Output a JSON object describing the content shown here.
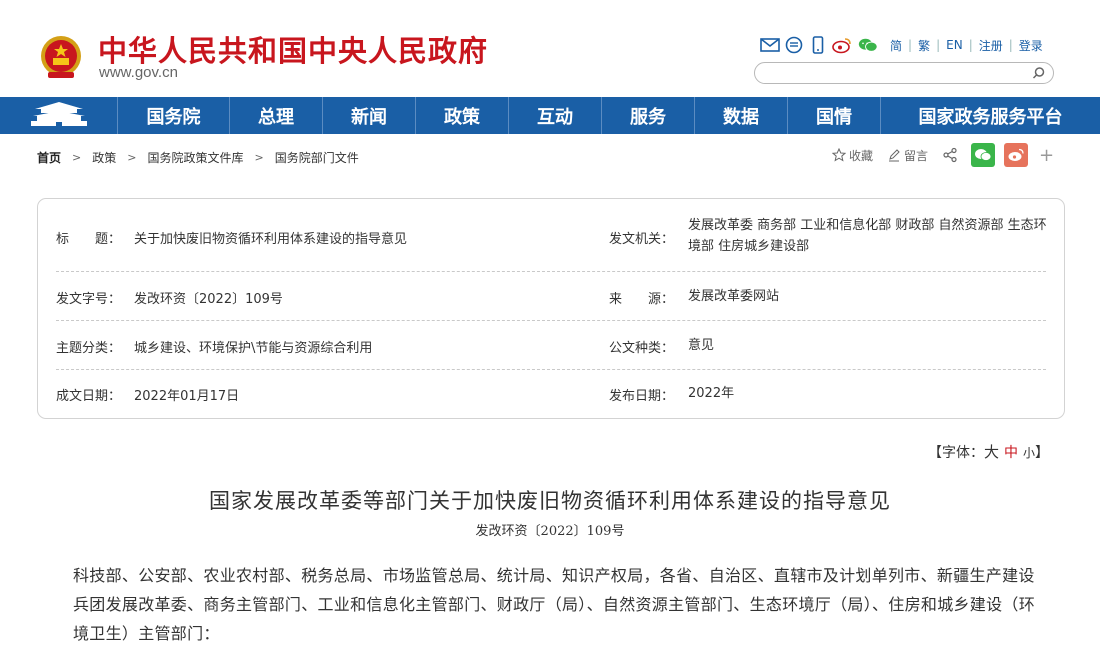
{
  "header": {
    "site_title": "中华人民共和国中央人民政府",
    "site_domain": "www.gov.cn",
    "tools": [
      {
        "icon": "mail-icon"
      },
      {
        "icon": "rss-icon"
      },
      {
        "icon": "mobile-icon"
      },
      {
        "icon": "weibo-icon"
      },
      {
        "icon": "wechat-icon"
      }
    ],
    "lang_links": [
      "简",
      "繁",
      "EN",
      "注册",
      "登录"
    ],
    "search_placeholder": ""
  },
  "nav": {
    "items": [
      "国务院",
      "总理",
      "新闻",
      "政策",
      "互动",
      "服务",
      "数据",
      "国情",
      "国家政务服务平台"
    ]
  },
  "breadcrumb": {
    "items": [
      "首页",
      "政策",
      "国务院政策文件库",
      "国务院部门文件"
    ]
  },
  "actions": {
    "favorite": "收藏",
    "comment": "留言"
  },
  "info": {
    "title_label": "标　　题：",
    "title_value": "关于加快废旧物资循环利用体系建设的指导意见",
    "issuer_label": "发文机关：",
    "issuer_value": "发展改革委  商务部  工业和信息化部  财政部  自然资源部  生态环境部  住房城乡建设部",
    "docno_label": "发文字号：",
    "docno_value": "发改环资〔2022〕109号",
    "source_label": "来　　源：",
    "source_value": "发展改革委网站",
    "topic_label": "主题分类：",
    "topic_value": "城乡建设、环境保护\\节能与资源综合利用",
    "doctype_label": "公文种类：",
    "doctype_value": "意见",
    "written_label": "成文日期：",
    "written_value": "2022年01月17日",
    "published_label": "发布日期：",
    "published_value": "2022年"
  },
  "font_control": {
    "prefix": "【字体：",
    "big": "大",
    "mid": "中",
    "small": "小",
    "suffix": "】"
  },
  "article": {
    "title": "国家发展改革委等部门关于加快废旧物资循环利用体系建设的指导意见",
    "doc_number": "发改环资〔2022〕109号",
    "body": "科技部、公安部、农业农村部、税务总局、市场监管总局、统计局、知识产权局，各省、自治区、直辖市及计划单列市、新疆生产建设兵团发展改革委、商务主管部门、工业和信息化主管部门、财政厅（局）、自然资源主管部门、生态环境厅（局）、住房和城乡建设（环境卫生）主管部门："
  },
  "colors": {
    "brand_red": "#c8161e",
    "nav_blue": "#1a5fa6",
    "wechat_green": "#3ab54a",
    "weibo_orange": "#e6735c"
  }
}
